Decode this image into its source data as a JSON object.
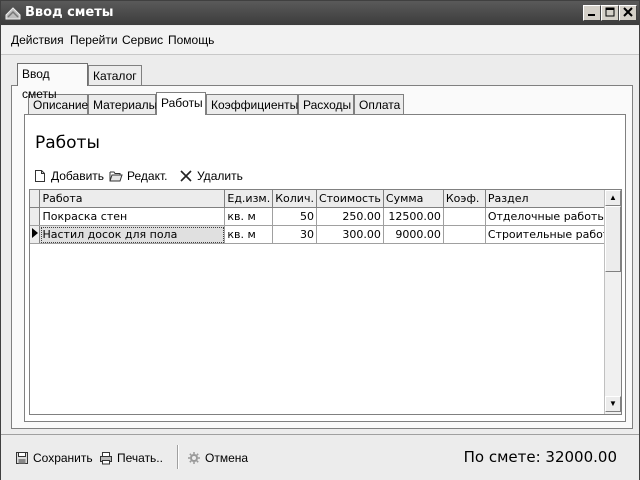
{
  "window": {
    "title": "Ввод сметы"
  },
  "menu": [
    "Действия",
    "Перейти",
    "Сервис",
    "Помощь"
  ],
  "outer_tabs": [
    "Ввод сметы",
    "Каталог"
  ],
  "inner_tabs": [
    "Описание",
    "Материалы",
    "Работы",
    "Коэффициенты",
    "Расходы",
    "Оплата"
  ],
  "section": {
    "title": "Работы"
  },
  "toolbar": {
    "add": "Добавить",
    "edit": "Редакт.",
    "delete": "Удалить"
  },
  "table": {
    "columns": [
      "Работа",
      "Ед.изм.",
      "Колич.",
      "Стоимость",
      "Сумма",
      "Коэф.",
      "Раздел"
    ],
    "rows": [
      [
        "Покраска стен",
        "кв. м",
        "50",
        "250.00",
        "12500.00",
        "",
        "Отделочные работы"
      ],
      [
        "Настил досок для пола",
        "кв. м",
        "30",
        "300.00",
        "9000.00",
        "",
        "Строительные работы"
      ]
    ]
  },
  "bottom": {
    "save": "Сохранить",
    "print": "Печать..",
    "cancel": "Отмена",
    "total": "По смете: 32000.00"
  }
}
